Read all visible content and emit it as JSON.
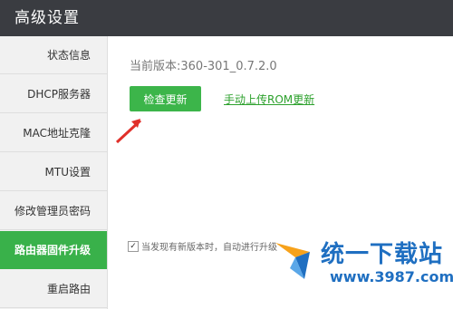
{
  "window": {
    "title": "高级设置"
  },
  "sidebar": {
    "items": [
      {
        "label": "状态信息"
      },
      {
        "label": "DHCP服务器"
      },
      {
        "label": "MAC地址克隆"
      },
      {
        "label": "MTU设置"
      },
      {
        "label": "修改管理员密码"
      },
      {
        "label": "路由器固件升级",
        "active": true
      },
      {
        "label": "重启路由"
      }
    ]
  },
  "main": {
    "version_label": "当前版本:360-301_0.7.2.0",
    "check_button": "检查更新",
    "upload_link": "手动上传ROM更新",
    "auto_upgrade_label": "当发现有新版本时，自动进行升级",
    "auto_upgrade_checked": true
  },
  "watermark": {
    "title": "统一下载站",
    "url": "www.3987.com"
  },
  "colors": {
    "accent": "#39b14a",
    "titlebar": "#3a3c41",
    "link": "#2da12d",
    "watermark": "#1f6fc1"
  },
  "icons": {
    "arrow": "red-arrow-icon",
    "logo": "download-site-logo-icon"
  }
}
